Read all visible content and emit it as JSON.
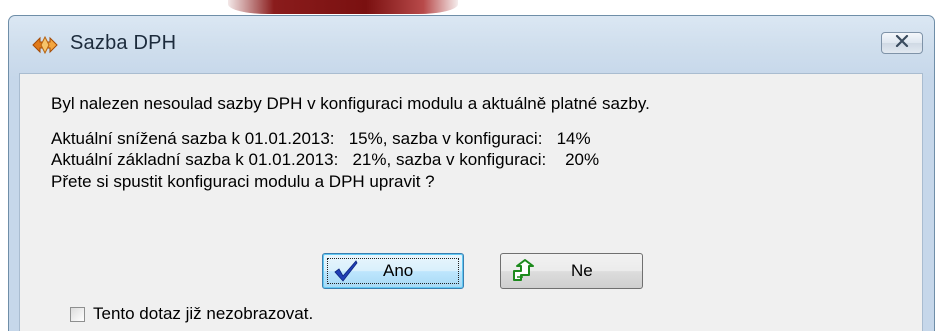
{
  "window": {
    "title": "Sazba DPH",
    "close_glyph": "✕"
  },
  "message": {
    "line1": "Byl nalezen nesoulad sazby DPH v konfiguraci modulu a aktuálně platné sazby.",
    "line2": "Aktuální snížená sazba k 01.01.2013:   15%, sazba v konfiguraci:   14%",
    "line3": "Aktuální základní sazba k 01.01.2013:   21%, sazba v konfiguraci:    20%",
    "line4": "Přete si spustit konfiguraci modulu a DPH upravit ?"
  },
  "buttons": {
    "yes_label": "Ano",
    "no_label": "Ne"
  },
  "checkbox": {
    "label": "Tento dotaz již nezobrazovat.",
    "checked": false
  },
  "icons": {
    "app": "app-arrows-icon",
    "yes": "checkmark-icon",
    "no": "green-arrow-icon",
    "close": "close-icon"
  }
}
